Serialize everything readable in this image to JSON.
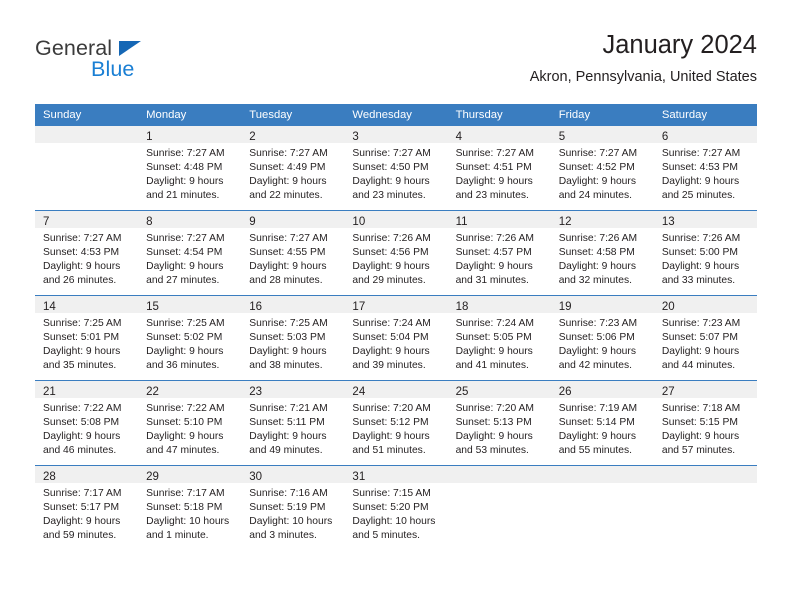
{
  "brand": {
    "name_part1": "General",
    "name_part2": "Blue",
    "color_dark": "#3b3b3b",
    "color_blue": "#1a7fd4"
  },
  "header": {
    "title": "January 2024",
    "location": "Akron, Pennsylvania, United States"
  },
  "theme": {
    "header_bar": "#3a7dc0",
    "daynum_band": "#f0f0f0",
    "text": "#231f20"
  },
  "weekday_headers": [
    "Sunday",
    "Monday",
    "Tuesday",
    "Wednesday",
    "Thursday",
    "Friday",
    "Saturday"
  ],
  "weeks": [
    [
      {
        "day": "",
        "sunrise": "",
        "sunset": "",
        "daylight1": "",
        "daylight2": ""
      },
      {
        "day": "1",
        "sunrise": "Sunrise: 7:27 AM",
        "sunset": "Sunset: 4:48 PM",
        "daylight1": "Daylight: 9 hours",
        "daylight2": "and 21 minutes."
      },
      {
        "day": "2",
        "sunrise": "Sunrise: 7:27 AM",
        "sunset": "Sunset: 4:49 PM",
        "daylight1": "Daylight: 9 hours",
        "daylight2": "and 22 minutes."
      },
      {
        "day": "3",
        "sunrise": "Sunrise: 7:27 AM",
        "sunset": "Sunset: 4:50 PM",
        "daylight1": "Daylight: 9 hours",
        "daylight2": "and 23 minutes."
      },
      {
        "day": "4",
        "sunrise": "Sunrise: 7:27 AM",
        "sunset": "Sunset: 4:51 PM",
        "daylight1": "Daylight: 9 hours",
        "daylight2": "and 23 minutes."
      },
      {
        "day": "5",
        "sunrise": "Sunrise: 7:27 AM",
        "sunset": "Sunset: 4:52 PM",
        "daylight1": "Daylight: 9 hours",
        "daylight2": "and 24 minutes."
      },
      {
        "day": "6",
        "sunrise": "Sunrise: 7:27 AM",
        "sunset": "Sunset: 4:53 PM",
        "daylight1": "Daylight: 9 hours",
        "daylight2": "and 25 minutes."
      }
    ],
    [
      {
        "day": "7",
        "sunrise": "Sunrise: 7:27 AM",
        "sunset": "Sunset: 4:53 PM",
        "daylight1": "Daylight: 9 hours",
        "daylight2": "and 26 minutes."
      },
      {
        "day": "8",
        "sunrise": "Sunrise: 7:27 AM",
        "sunset": "Sunset: 4:54 PM",
        "daylight1": "Daylight: 9 hours",
        "daylight2": "and 27 minutes."
      },
      {
        "day": "9",
        "sunrise": "Sunrise: 7:27 AM",
        "sunset": "Sunset: 4:55 PM",
        "daylight1": "Daylight: 9 hours",
        "daylight2": "and 28 minutes."
      },
      {
        "day": "10",
        "sunrise": "Sunrise: 7:26 AM",
        "sunset": "Sunset: 4:56 PM",
        "daylight1": "Daylight: 9 hours",
        "daylight2": "and 29 minutes."
      },
      {
        "day": "11",
        "sunrise": "Sunrise: 7:26 AM",
        "sunset": "Sunset: 4:57 PM",
        "daylight1": "Daylight: 9 hours",
        "daylight2": "and 31 minutes."
      },
      {
        "day": "12",
        "sunrise": "Sunrise: 7:26 AM",
        "sunset": "Sunset: 4:58 PM",
        "daylight1": "Daylight: 9 hours",
        "daylight2": "and 32 minutes."
      },
      {
        "day": "13",
        "sunrise": "Sunrise: 7:26 AM",
        "sunset": "Sunset: 5:00 PM",
        "daylight1": "Daylight: 9 hours",
        "daylight2": "and 33 minutes."
      }
    ],
    [
      {
        "day": "14",
        "sunrise": "Sunrise: 7:25 AM",
        "sunset": "Sunset: 5:01 PM",
        "daylight1": "Daylight: 9 hours",
        "daylight2": "and 35 minutes."
      },
      {
        "day": "15",
        "sunrise": "Sunrise: 7:25 AM",
        "sunset": "Sunset: 5:02 PM",
        "daylight1": "Daylight: 9 hours",
        "daylight2": "and 36 minutes."
      },
      {
        "day": "16",
        "sunrise": "Sunrise: 7:25 AM",
        "sunset": "Sunset: 5:03 PM",
        "daylight1": "Daylight: 9 hours",
        "daylight2": "and 38 minutes."
      },
      {
        "day": "17",
        "sunrise": "Sunrise: 7:24 AM",
        "sunset": "Sunset: 5:04 PM",
        "daylight1": "Daylight: 9 hours",
        "daylight2": "and 39 minutes."
      },
      {
        "day": "18",
        "sunrise": "Sunrise: 7:24 AM",
        "sunset": "Sunset: 5:05 PM",
        "daylight1": "Daylight: 9 hours",
        "daylight2": "and 41 minutes."
      },
      {
        "day": "19",
        "sunrise": "Sunrise: 7:23 AM",
        "sunset": "Sunset: 5:06 PM",
        "daylight1": "Daylight: 9 hours",
        "daylight2": "and 42 minutes."
      },
      {
        "day": "20",
        "sunrise": "Sunrise: 7:23 AM",
        "sunset": "Sunset: 5:07 PM",
        "daylight1": "Daylight: 9 hours",
        "daylight2": "and 44 minutes."
      }
    ],
    [
      {
        "day": "21",
        "sunrise": "Sunrise: 7:22 AM",
        "sunset": "Sunset: 5:08 PM",
        "daylight1": "Daylight: 9 hours",
        "daylight2": "and 46 minutes."
      },
      {
        "day": "22",
        "sunrise": "Sunrise: 7:22 AM",
        "sunset": "Sunset: 5:10 PM",
        "daylight1": "Daylight: 9 hours",
        "daylight2": "and 47 minutes."
      },
      {
        "day": "23",
        "sunrise": "Sunrise: 7:21 AM",
        "sunset": "Sunset: 5:11 PM",
        "daylight1": "Daylight: 9 hours",
        "daylight2": "and 49 minutes."
      },
      {
        "day": "24",
        "sunrise": "Sunrise: 7:20 AM",
        "sunset": "Sunset: 5:12 PM",
        "daylight1": "Daylight: 9 hours",
        "daylight2": "and 51 minutes."
      },
      {
        "day": "25",
        "sunrise": "Sunrise: 7:20 AM",
        "sunset": "Sunset: 5:13 PM",
        "daylight1": "Daylight: 9 hours",
        "daylight2": "and 53 minutes."
      },
      {
        "day": "26",
        "sunrise": "Sunrise: 7:19 AM",
        "sunset": "Sunset: 5:14 PM",
        "daylight1": "Daylight: 9 hours",
        "daylight2": "and 55 minutes."
      },
      {
        "day": "27",
        "sunrise": "Sunrise: 7:18 AM",
        "sunset": "Sunset: 5:15 PM",
        "daylight1": "Daylight: 9 hours",
        "daylight2": "and 57 minutes."
      }
    ],
    [
      {
        "day": "28",
        "sunrise": "Sunrise: 7:17 AM",
        "sunset": "Sunset: 5:17 PM",
        "daylight1": "Daylight: 9 hours",
        "daylight2": "and 59 minutes."
      },
      {
        "day": "29",
        "sunrise": "Sunrise: 7:17 AM",
        "sunset": "Sunset: 5:18 PM",
        "daylight1": "Daylight: 10 hours",
        "daylight2": "and 1 minute."
      },
      {
        "day": "30",
        "sunrise": "Sunrise: 7:16 AM",
        "sunset": "Sunset: 5:19 PM",
        "daylight1": "Daylight: 10 hours",
        "daylight2": "and 3 minutes."
      },
      {
        "day": "31",
        "sunrise": "Sunrise: 7:15 AM",
        "sunset": "Sunset: 5:20 PM",
        "daylight1": "Daylight: 10 hours",
        "daylight2": "and 5 minutes."
      },
      {
        "day": "",
        "sunrise": "",
        "sunset": "",
        "daylight1": "",
        "daylight2": ""
      },
      {
        "day": "",
        "sunrise": "",
        "sunset": "",
        "daylight1": "",
        "daylight2": ""
      },
      {
        "day": "",
        "sunrise": "",
        "sunset": "",
        "daylight1": "",
        "daylight2": ""
      }
    ]
  ]
}
